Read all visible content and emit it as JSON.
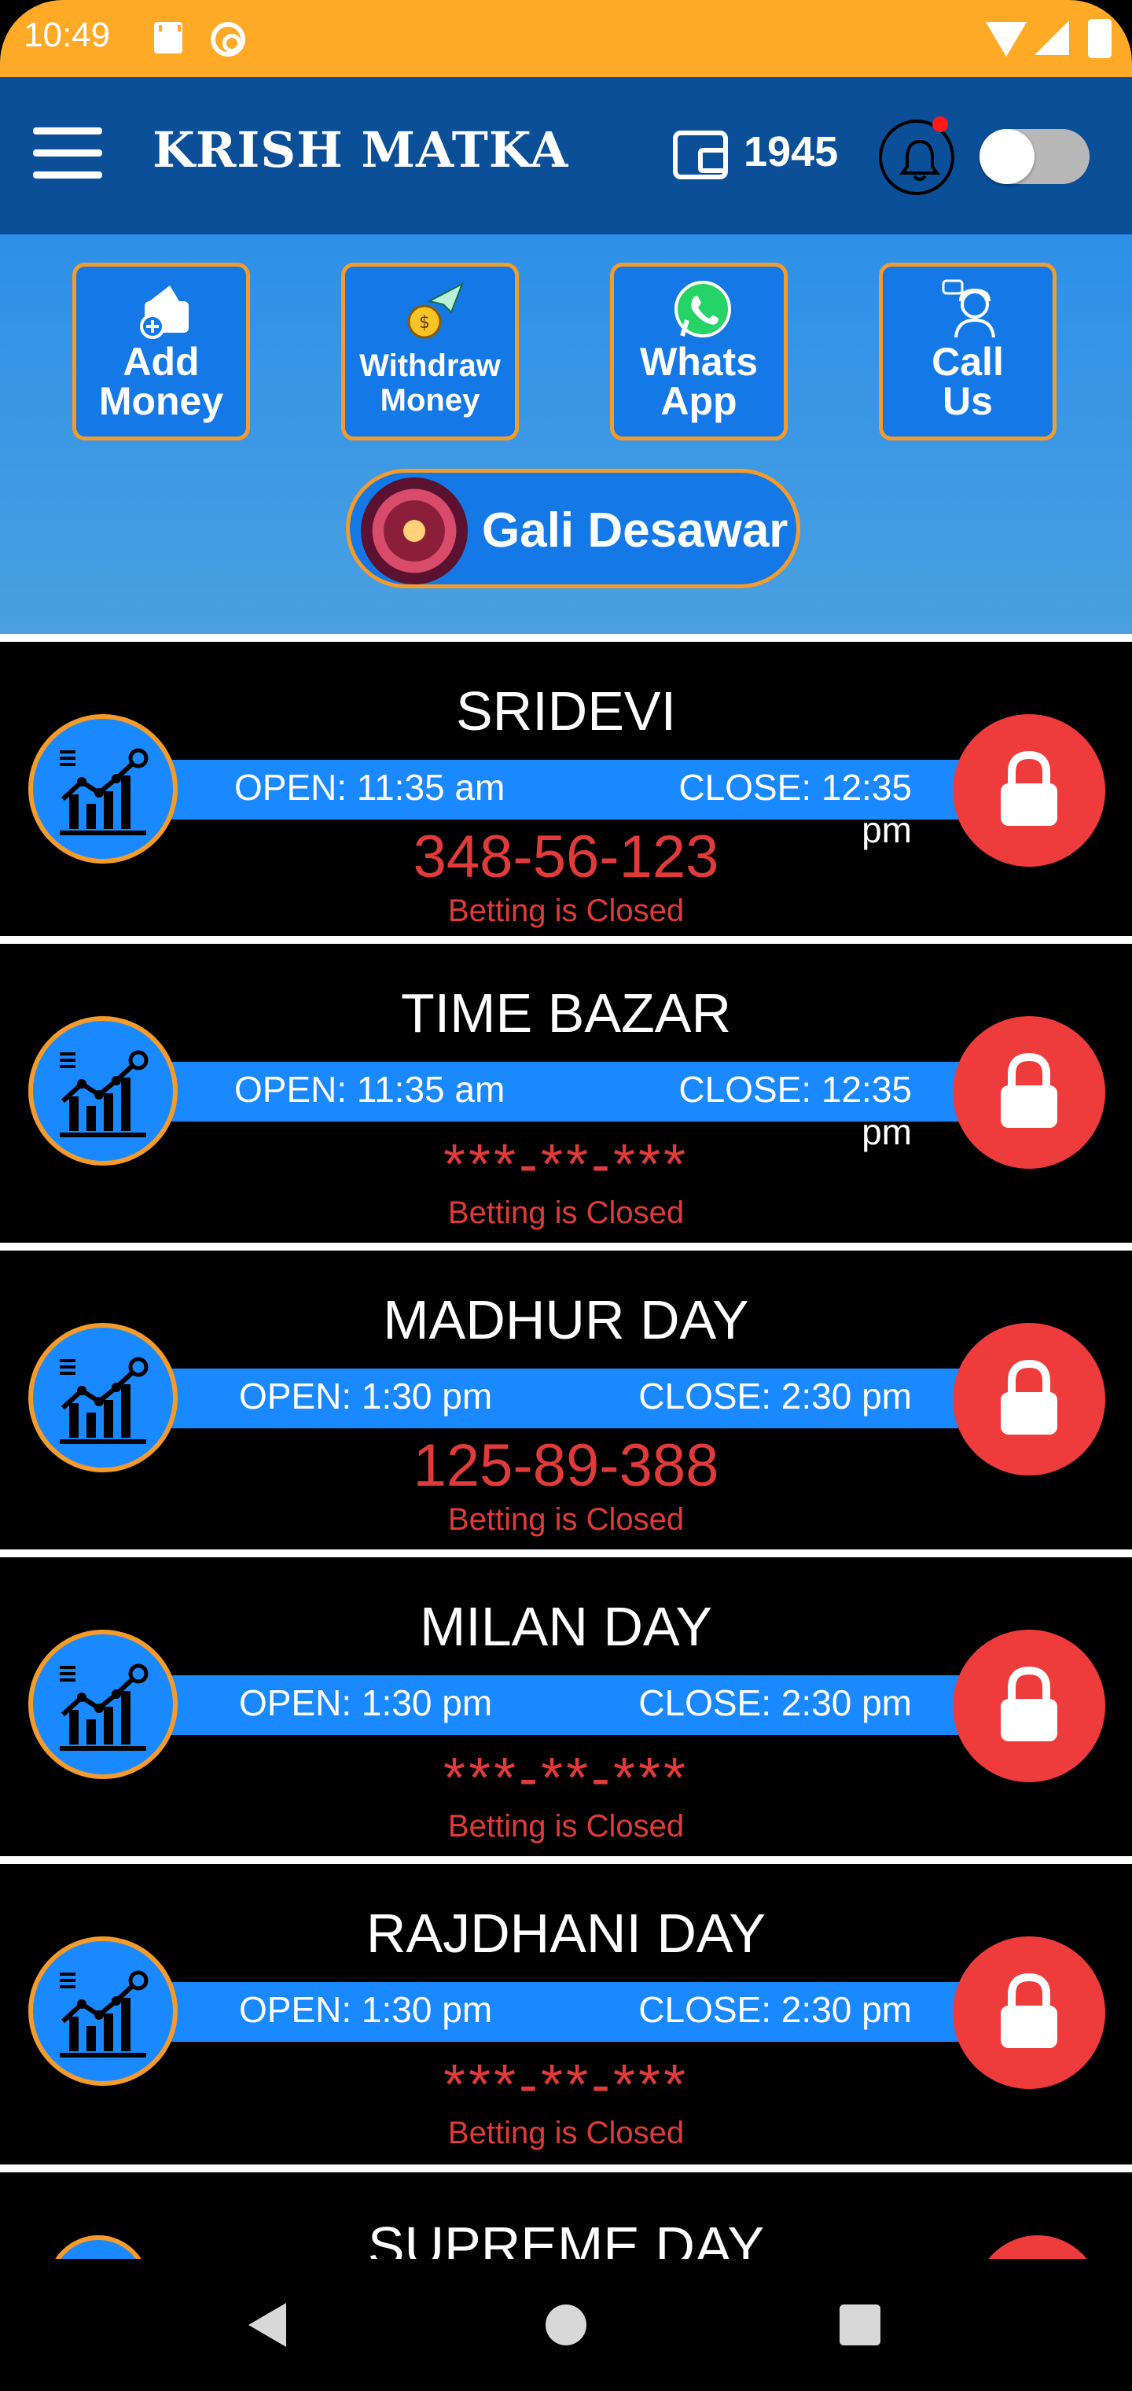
{
  "status_bar": {
    "time": "10:49"
  },
  "header": {
    "title": "KRISH MATKA",
    "wallet_balance": "1945"
  },
  "actions": [
    {
      "label": "Add\nMoney"
    },
    {
      "label": "Withdraw\nMoney"
    },
    {
      "label": "Whats\nApp"
    },
    {
      "label": "Call\nUs"
    }
  ],
  "gali_button": {
    "label": "Gali Desawar"
  },
  "games": [
    {
      "name": "SRIDEVI",
      "open": "OPEN: 11:35 am",
      "close": "CLOSE: 12:35 pm",
      "result": "348-56-123",
      "status": "Betting is Closed"
    },
    {
      "name": "TIME BAZAR",
      "open": "OPEN: 11:35 am",
      "close": "CLOSE: 12:35 pm",
      "result": "***-**-***",
      "status": "Betting is Closed"
    },
    {
      "name": "MADHUR DAY",
      "open": "OPEN: 1:30 pm",
      "close": "CLOSE: 2:30 pm",
      "result": "125-89-388",
      "status": "Betting is Closed"
    },
    {
      "name": "MILAN DAY",
      "open": "OPEN: 1:30 pm",
      "close": "CLOSE: 2:30 pm",
      "result": "***-**-***",
      "status": "Betting is Closed"
    },
    {
      "name": "RAJDHANI DAY",
      "open": "OPEN: 1:30 pm",
      "close": "CLOSE: 2:30 pm",
      "result": "***-**-***",
      "status": "Betting is Closed"
    }
  ],
  "partial_game": {
    "name": "SUPREME DAY"
  },
  "colors": {
    "status_bar": "#ffaa27",
    "header": "#0a4f97",
    "accent_blue": "#1a88ff",
    "border_orange": "#f59b2a",
    "lock_red": "#ee3b3b",
    "result_red": "#e03a3a"
  },
  "icons": {
    "menu": "hamburger-icon",
    "wallet": "wallet-icon",
    "notification": "bell-icon",
    "chart": "chart-icon",
    "lock": "lock-icon"
  }
}
